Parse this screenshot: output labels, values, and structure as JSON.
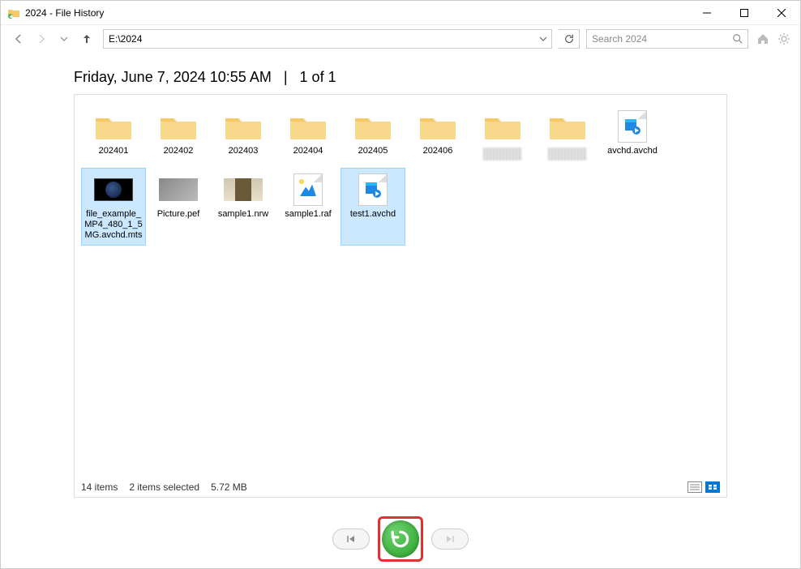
{
  "window": {
    "title": "2024 - File History"
  },
  "nav": {
    "address": "E:\\2024",
    "search_placeholder": "Search 2024"
  },
  "header": {
    "timestamp": "Friday, June 7, 2024 10:55 AM",
    "page_counter": "1 of 1",
    "separator": "|"
  },
  "items": [
    {
      "name": "202401",
      "type": "folder",
      "selected": false
    },
    {
      "name": "202402",
      "type": "folder",
      "selected": false
    },
    {
      "name": "202403",
      "type": "folder",
      "selected": false
    },
    {
      "name": "202404",
      "type": "folder",
      "selected": false
    },
    {
      "name": "202405",
      "type": "folder",
      "selected": false
    },
    {
      "name": "202406",
      "type": "folder",
      "selected": false
    },
    {
      "name": "",
      "type": "folder-blurred",
      "selected": false
    },
    {
      "name": "",
      "type": "folder-blurred",
      "selected": false
    },
    {
      "name": "avchd.avchd",
      "type": "avchd",
      "selected": false
    },
    {
      "name": "file_example_MP4_480_1_5MG.avchd.mts",
      "type": "video-thumb",
      "selected": true
    },
    {
      "name": "Picture.pef",
      "type": "pic1",
      "selected": false
    },
    {
      "name": "sample1.nrw",
      "type": "pic2",
      "selected": false
    },
    {
      "name": "sample1.raf",
      "type": "raf",
      "selected": false
    },
    {
      "name": "test1.avchd",
      "type": "avchd",
      "selected": true
    }
  ],
  "status": {
    "item_count": "14 items",
    "selection": "2 items selected",
    "size": "5.72 MB"
  }
}
